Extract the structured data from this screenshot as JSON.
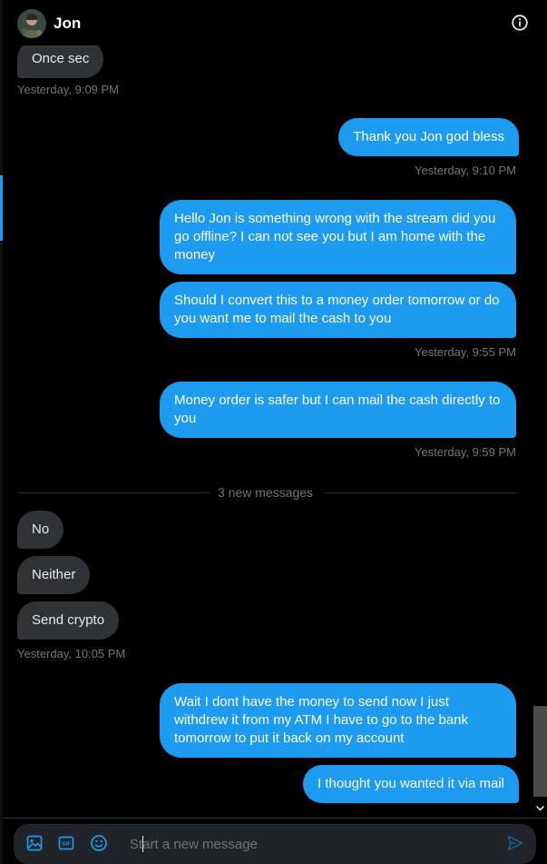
{
  "header": {
    "name": "Jon"
  },
  "conversation": {
    "messages": [
      {
        "text": "Once sec",
        "dir": "in"
      },
      {
        "text": "Thank you Jon god bless",
        "dir": "out"
      },
      {
        "text": "Hello Jon is something wrong with the stream did you go offline? I can not see you but I am home with the money",
        "dir": "out"
      },
      {
        "text": "Should I convert this to a money order tomorrow or do you want me to mail the cash to you",
        "dir": "out"
      },
      {
        "text": "Money order is safer but I can mail the cash directly to you",
        "dir": "out"
      },
      {
        "text": "No",
        "dir": "in"
      },
      {
        "text": "Neither",
        "dir": "in"
      },
      {
        "text": "Send crypto",
        "dir": "in"
      },
      {
        "text": "Wait I dont have the money to send now I just withdrew it from my ATM I have to go to the bank tomorrow to put it back on my account",
        "dir": "out"
      },
      {
        "text": "I thought you wanted it via mail",
        "dir": "out"
      }
    ],
    "timestamps": [
      "Yesterday, 9:09 PM",
      "Yesterday, 9:10 PM",
      "Yesterday, 9:55 PM",
      "Yesterday, 9:59 PM",
      "Yesterday, 10:05 PM"
    ],
    "new_messages_label": "3 new messages"
  },
  "composer": {
    "placeholder": "Start a new message",
    "icons": [
      "image-icon",
      "gif-icon",
      "emoji-icon",
      "send-icon"
    ]
  },
  "colors": {
    "accent": "#1d9bf0",
    "incoming_bubble": "#2f3336",
    "background": "#000000",
    "muted_text": "#71767b"
  }
}
